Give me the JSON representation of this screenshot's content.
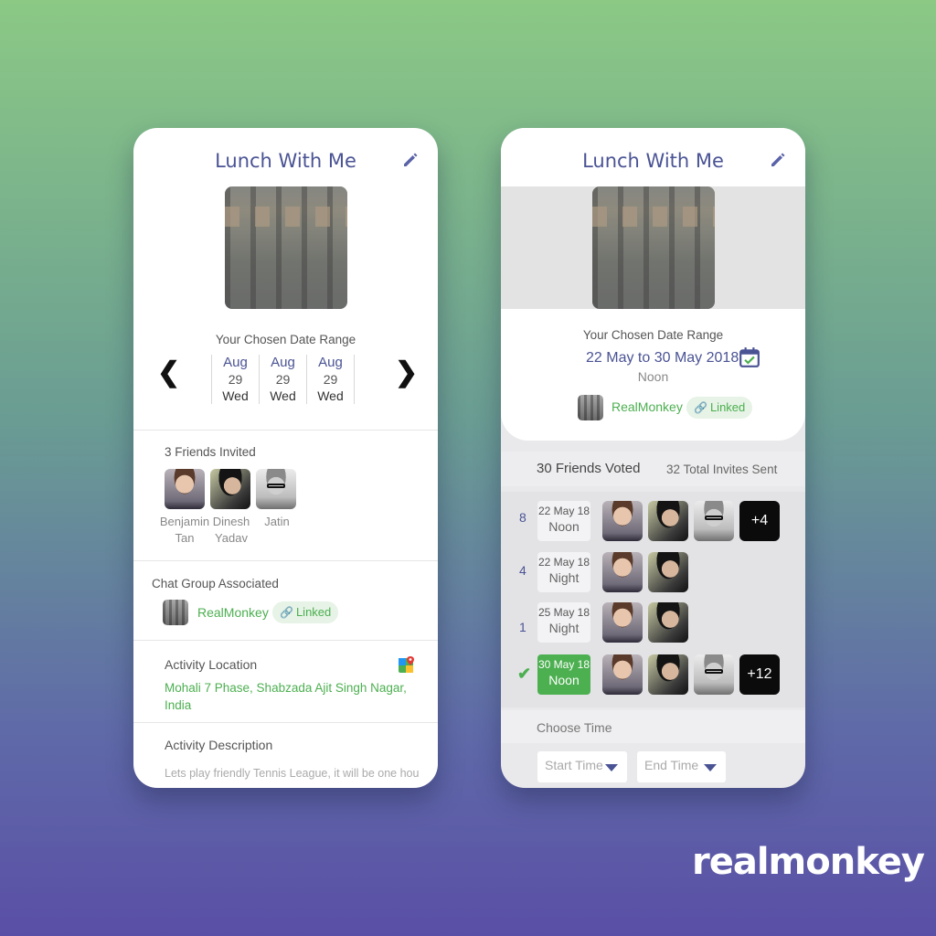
{
  "left": {
    "title": "Lunch With Me",
    "date_range_label": "Your Chosen Date Range",
    "dates": [
      {
        "month": "Aug",
        "day": "29",
        "weekday": "Wed"
      },
      {
        "month": "Aug",
        "day": "29",
        "weekday": "Wed"
      },
      {
        "month": "Aug",
        "day": "29",
        "weekday": "Wed"
      }
    ],
    "friends_label": "3 Friends Invited",
    "friends": [
      {
        "first": "Benjamin",
        "last": "Tan"
      },
      {
        "first": "Dinesh",
        "last": "Yadav"
      },
      {
        "first": "Jatin",
        "last": ""
      }
    ],
    "chat_group_label": "Chat Group Associated",
    "chat_group_name": "RealMonkey",
    "linked_label": "Linked",
    "location_label": "Activity Location",
    "location_value": "Mohali 7 Phase, Shabzada Ajit Singh Nagar, India",
    "description_label": "Activity Description",
    "description_value": "Lets play friendly Tennis League, it will be one hou"
  },
  "right": {
    "title": "Lunch With Me",
    "date_range_label": "Your Chosen Date Range",
    "date_range_value": "22 May to 30 May 2018",
    "time_of_day": "Noon",
    "chat_group_name": "RealMonkey",
    "linked_label": "Linked",
    "voted_label": "30 Friends Voted",
    "invites_label": "32 Total Invites Sent",
    "votes": [
      {
        "count": "8",
        "date": "22 May 18",
        "time": "Noon",
        "more": "+4",
        "chosen": false
      },
      {
        "count": "4",
        "date": "22 May 18",
        "time": "Night",
        "more": "",
        "chosen": false
      },
      {
        "count": "1",
        "date": "25 May 18",
        "time": "Night",
        "more": "",
        "chosen": false
      },
      {
        "count": "",
        "date": "30 May 18",
        "time": "Noon",
        "more": "+12",
        "chosen": true
      }
    ],
    "choose_time_label": "Choose Time",
    "start_time_placeholder": "Start Time",
    "end_time_placeholder": "End Time"
  },
  "brand": "realmonkey",
  "colors": {
    "accent": "#4a5394",
    "green": "#4caf50"
  }
}
